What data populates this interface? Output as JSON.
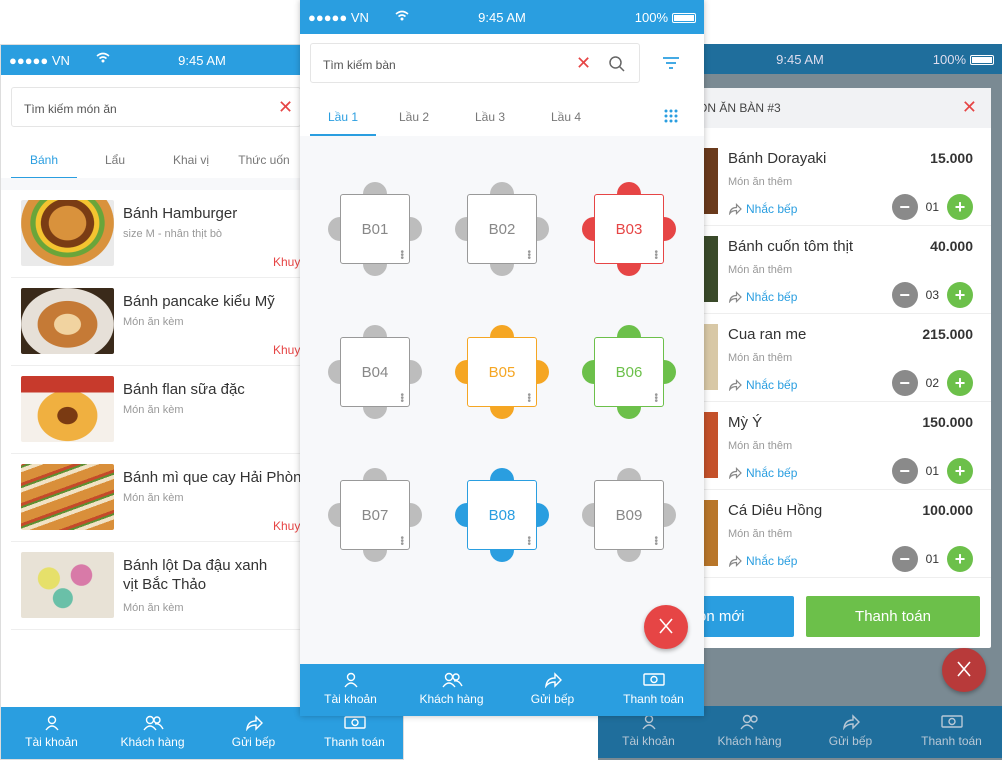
{
  "colors": {
    "primary": "#2a9ee0",
    "danger": "#e64545",
    "orange": "#f5a623",
    "green": "#6cc04a",
    "gray": "#bdbdbd"
  },
  "status": {
    "carrier": "●●●●● VN",
    "time": "9:45 AM",
    "battery": "100%"
  },
  "left": {
    "search_placeholder": "Tìm kiếm món ăn",
    "tabs": [
      "Bánh",
      "Lẩu",
      "Khai vị",
      "Thức uốn"
    ],
    "foods": [
      {
        "name": "Bánh Hamburger",
        "sub": "size M - nhân thịt bò",
        "promo": "Khuyế"
      },
      {
        "name": "Bánh pancake kiểu Mỹ",
        "sub": "Món ăn kèm",
        "promo": "Khuyế"
      },
      {
        "name": "Bánh flan sữa đặc",
        "sub": "Món ăn kèm",
        "promo": ""
      },
      {
        "name": "Bánh mì que cay Hải Phòng",
        "sub": "Món ăn kèm",
        "promo": "Khuyế"
      },
      {
        "name": "Bánh lột Da đậu xanh",
        "name2": "vịt Bắc Thảo",
        "sub": "Món ăn kèm",
        "promo": ""
      }
    ]
  },
  "center": {
    "search_placeholder": "Tìm kiếm bàn",
    "tabs": [
      "Lầu 1",
      "Lầu 2",
      "Lầu 3",
      "Lầu 4"
    ],
    "tables": [
      {
        "label": "B01",
        "state": "empty"
      },
      {
        "label": "B02",
        "state": "empty"
      },
      {
        "label": "B03",
        "state": "red"
      },
      {
        "label": "B04",
        "state": "empty"
      },
      {
        "label": "B05",
        "state": "orange"
      },
      {
        "label": "B06",
        "state": "green"
      },
      {
        "label": "B07",
        "state": "empty"
      },
      {
        "label": "B08",
        "state": "blue"
      },
      {
        "label": "B09",
        "state": "empty"
      }
    ]
  },
  "right": {
    "dialog_title": "ÓN ĂN BÀN #3",
    "items": [
      {
        "name": "Bánh Dorayaki",
        "price": "15.000",
        "sub": "Món ăn thêm",
        "remind": "Nhắc bếp",
        "qty": "01"
      },
      {
        "name": "Bánh cuốn tôm thịt",
        "price": "40.000",
        "sub": "Món ăn thêm",
        "remind": "Nhắc bếp",
        "qty": "03"
      },
      {
        "name": "Cua ran me",
        "price": "215.000",
        "sub": "Món ăn thêm",
        "remind": "Nhắc bếp",
        "qty": "02"
      },
      {
        "name": "Mỳ Ý",
        "price": "150.000",
        "sub": "Món ăn thêm",
        "remind": "Nhắc bếp",
        "qty": "01"
      },
      {
        "name": "Cá Diêu Hồng",
        "price": "100.000",
        "sub": "Món ăn thêm",
        "remind": "Nhắc bếp",
        "qty": "01"
      }
    ],
    "btn_new": "ón mới",
    "btn_pay": "Thanh toán"
  },
  "nav": {
    "account": "Tài khoản",
    "customers": "Khách hàng",
    "kitchen": "Gửi bếp",
    "pay": "Thanh toán"
  }
}
